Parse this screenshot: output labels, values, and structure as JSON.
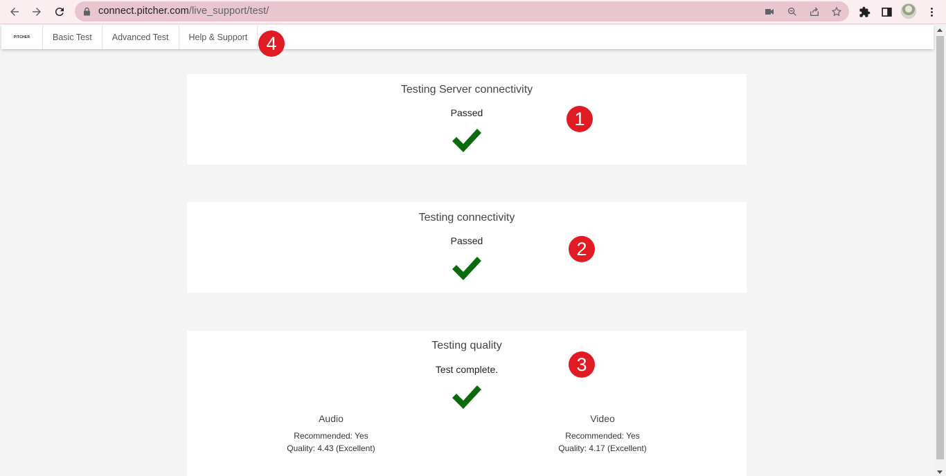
{
  "browser": {
    "url_host": "connect.pitcher.com",
    "url_path": "/live_support/test/"
  },
  "nav": {
    "logo": "PITCHER",
    "items": [
      "Basic Test",
      "Advanced Test",
      "Help & Support"
    ]
  },
  "annotations": [
    "1",
    "2",
    "3",
    "4"
  ],
  "cards": {
    "server": {
      "title": "Testing Server connectivity",
      "status": "Passed"
    },
    "connectivity": {
      "title": "Testing connectivity",
      "status": "Passed"
    },
    "quality": {
      "title": "Testing quality",
      "status": "Test complete.",
      "audio": {
        "title": "Audio",
        "recommended": "Recommended: Yes",
        "quality": "Quality: 4.43 (Excellent)"
      },
      "video": {
        "title": "Video",
        "recommended": "Recommended: Yes",
        "quality": "Quality: 4.17 (Excellent)"
      }
    }
  },
  "colors": {
    "check": "#0b6a0b",
    "badge": "#e01b24",
    "chrome": "#fbeef1",
    "omnibox": "#e9c6cf"
  }
}
